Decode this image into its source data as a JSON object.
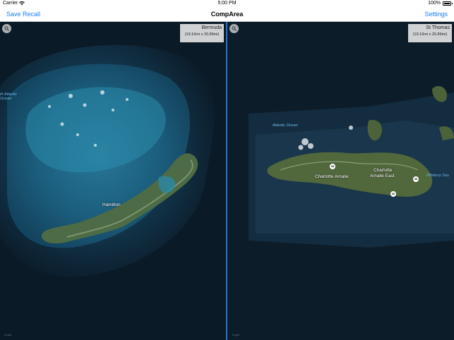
{
  "status_bar": {
    "carrier": "Carrier",
    "time": "5:00 PM",
    "battery": "100%"
  },
  "nav": {
    "save": "Save",
    "recall": "Recall",
    "title": "CompArea",
    "settings": "Settings"
  },
  "left_map": {
    "location": "Bermuda",
    "dimensions": "(19.10mi x 26.89mi)",
    "ocean_label_1": "th Atlantic",
    "ocean_label_2": "Ocean",
    "city": "Hamilton",
    "legal": "Legal"
  },
  "right_map": {
    "location": "St Thomas",
    "dimensions": "(19.10mi x 26.89mi)",
    "ocean_label": "Atlantic Ocean",
    "city_1": "Charlotte Amalie",
    "city_2a": "Charlotte",
    "city_2b": "Amalie East",
    "sound_label": "Pillsbury Sou",
    "route_a": "38",
    "route_b": "38",
    "route_c": "30",
    "legal": "Legal"
  },
  "colors": {
    "accent": "#1a7cf5",
    "divider": "#2a6fd6"
  },
  "icons": {
    "search": "magnifier-icon",
    "wifi": "wifi-icon",
    "battery": "battery-icon"
  }
}
